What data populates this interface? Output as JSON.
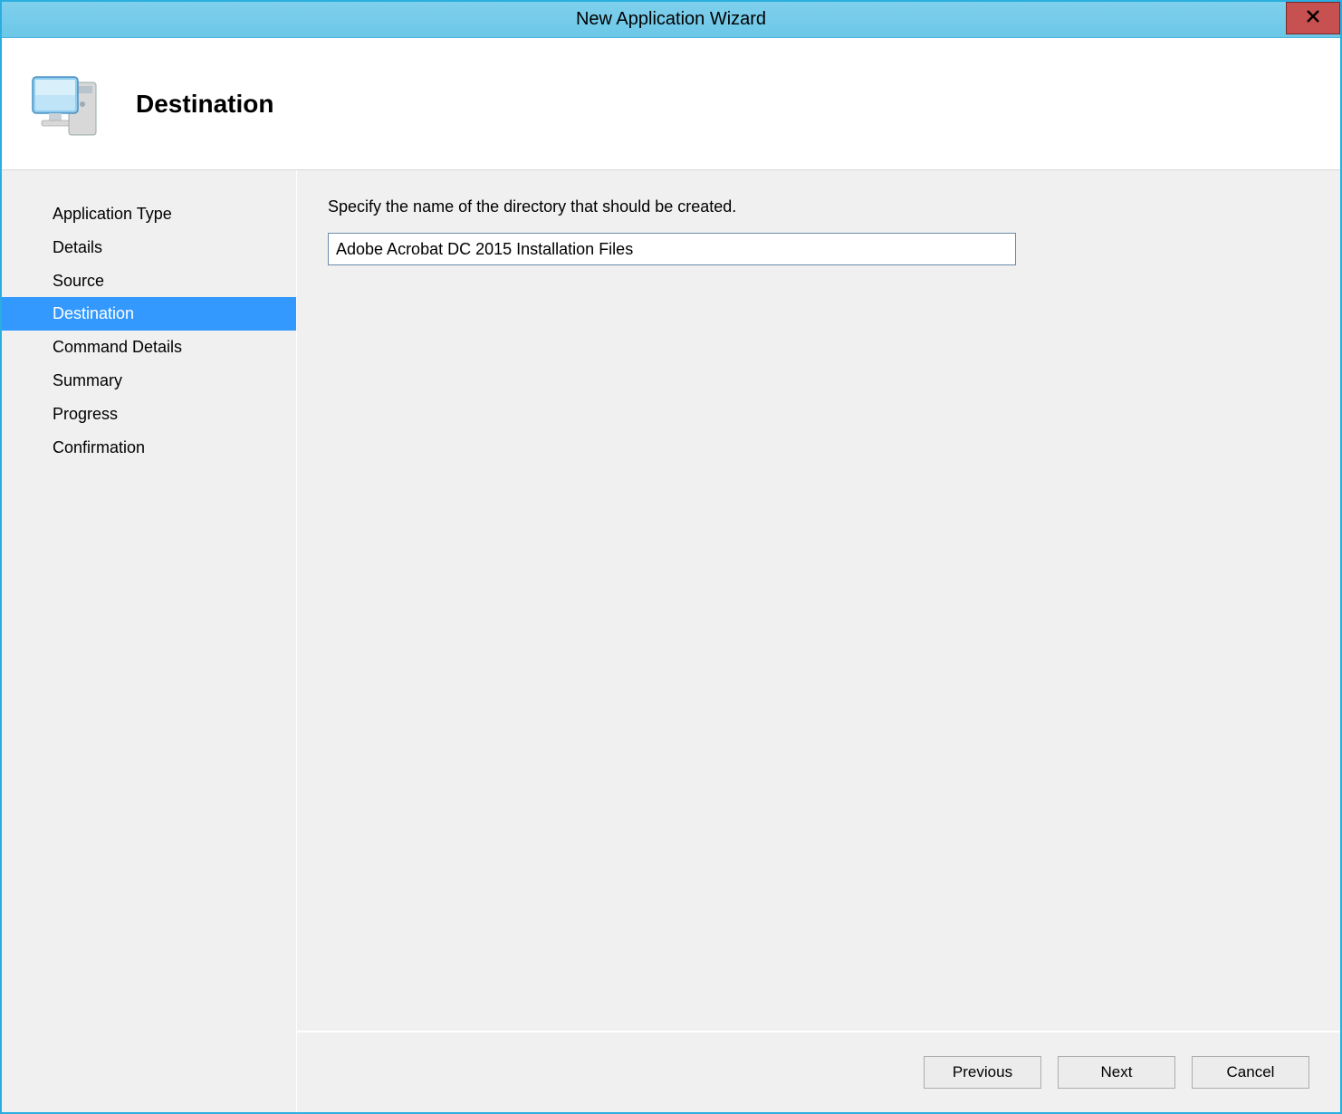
{
  "window": {
    "title": "New Application Wizard"
  },
  "header": {
    "page_title": "Destination"
  },
  "sidebar": {
    "steps": [
      {
        "label": "Application Type",
        "selected": false
      },
      {
        "label": "Details",
        "selected": false
      },
      {
        "label": "Source",
        "selected": false
      },
      {
        "label": "Destination",
        "selected": true
      },
      {
        "label": "Command Details",
        "selected": false
      },
      {
        "label": "Summary",
        "selected": false
      },
      {
        "label": "Progress",
        "selected": false
      },
      {
        "label": "Confirmation",
        "selected": false
      }
    ]
  },
  "main": {
    "instruction": "Specify the name of the directory that should be created.",
    "directory_value": "Adobe Acrobat DC 2015 Installation Files"
  },
  "buttons": {
    "previous": "Previous",
    "next": "Next",
    "cancel": "Cancel"
  },
  "icons": {
    "close": "close-icon",
    "wizard": "computer-monitor-icon"
  }
}
